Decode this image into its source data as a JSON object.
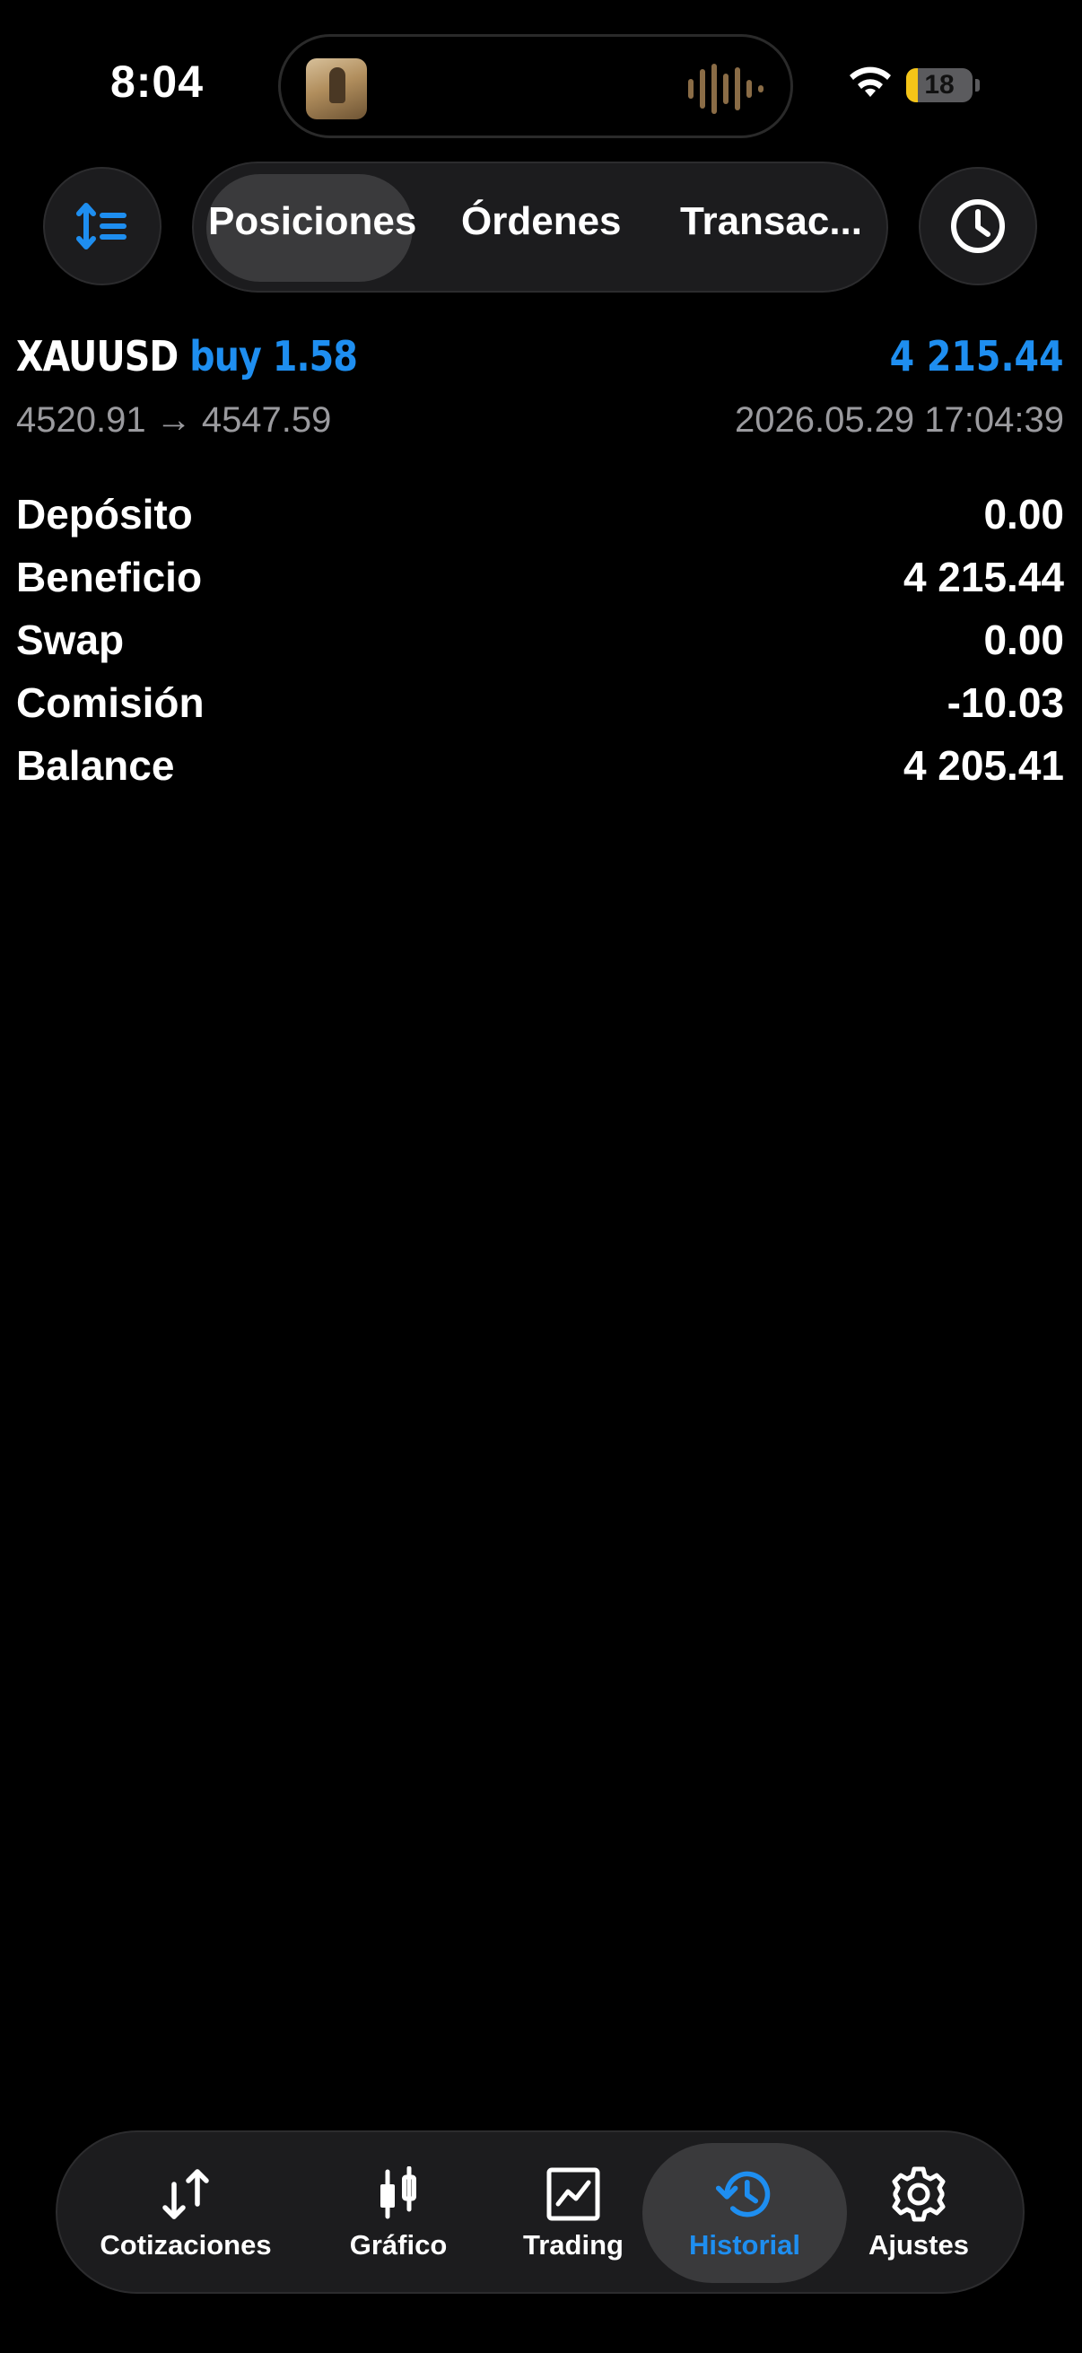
{
  "status_bar": {
    "time": "8:04",
    "battery_level": "18",
    "battery_color": "#f5c518"
  },
  "header": {
    "sort_icon": "sort-list-icon",
    "tabs": [
      {
        "label": "Posiciones",
        "active": true
      },
      {
        "label": "Órdenes",
        "active": false
      },
      {
        "label": "Transac...",
        "active": false
      }
    ],
    "period_icon": "clock-icon"
  },
  "deal": {
    "symbol": "XAUUSD",
    "side": "buy 1.58",
    "profit": "4 215.44",
    "prices": "4520.91 → 4547.59",
    "time": "2026.05.29 17:04:39"
  },
  "summary": [
    {
      "label": "Depósito",
      "value": "0.00"
    },
    {
      "label": "Beneficio",
      "value": "4 215.44"
    },
    {
      "label": "Swap",
      "value": "0.00"
    },
    {
      "label": "Comisión",
      "value": "-10.03"
    },
    {
      "label": "Balance",
      "value": "4 205.41"
    }
  ],
  "nav": [
    {
      "label": "Cotizaciones",
      "icon": "quotes-arrows-icon",
      "active": false
    },
    {
      "label": "Gráfico",
      "icon": "candlestick-icon",
      "active": false
    },
    {
      "label": "Trading",
      "icon": "trade-chart-icon",
      "active": false
    },
    {
      "label": "Historial",
      "icon": "history-icon",
      "active": true
    },
    {
      "label": "Ajustes",
      "icon": "gear-icon",
      "active": false
    }
  ],
  "colors": {
    "accent": "#1e8ef0",
    "background": "#000000",
    "muted_text": "#9a9a9e"
  }
}
